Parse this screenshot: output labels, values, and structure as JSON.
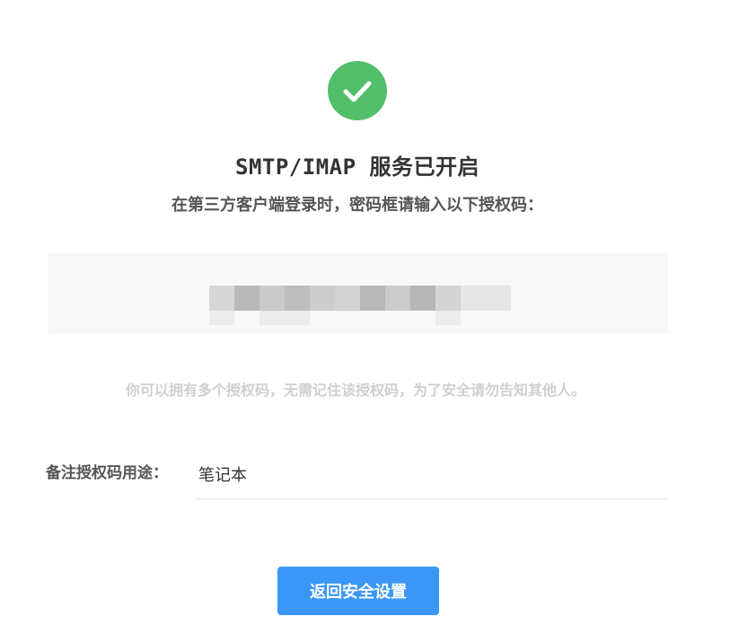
{
  "status": {
    "icon": "check-circle-icon",
    "icon_color": "#52be6a",
    "title": "SMTP/IMAP 服务已开启",
    "instruction": "在第三方客户端登录时，密码框请输入以下授权码："
  },
  "auth_code": {
    "obscured": true,
    "background": "#f8f8f8"
  },
  "hint": "你可以拥有多个授权码，无需记住该授权码，为了安全请勿告知其他人。",
  "note": {
    "label": "备注授权码用途：",
    "value": "笔记本"
  },
  "actions": {
    "back_label": "返回安全设置",
    "button_color": "#3b97f5"
  }
}
